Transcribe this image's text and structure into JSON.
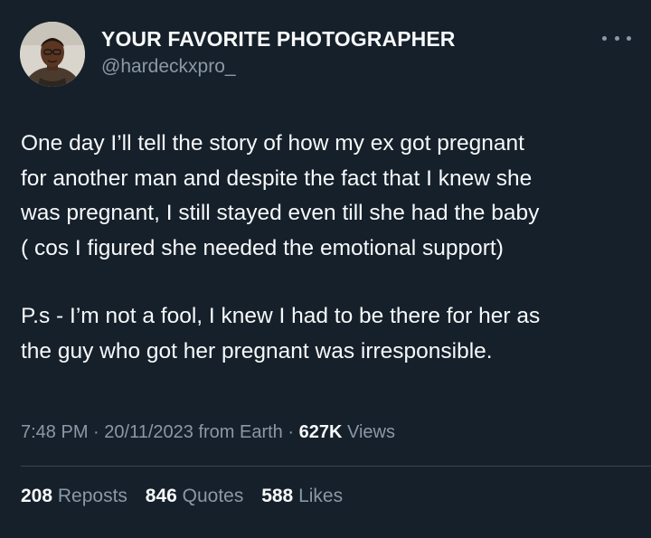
{
  "author": {
    "display_name": "YOUR FAVORITE PHOTOGRAPHER",
    "handle": "@hardeckxpro_",
    "avatar_icon": "user-avatar"
  },
  "more_icon": "more-horizontal-icon",
  "tweet": {
    "paragraph_1": [
      "One day I’ll tell the story of how my ex got pregnant",
      "for another man and despite the fact that I knew she",
      "was pregnant, I still stayed even till she had the baby",
      "( cos I figured she needed the emotional support)"
    ],
    "paragraph_2": [
      "P.s - I’m not a fool, I knew I had to be there for her as",
      "the guy who got her pregnant was irresponsible."
    ]
  },
  "meta": {
    "time": "7:48 PM",
    "separator": " · ",
    "date": "20/11/2023",
    "source": " from Earth",
    "views_count": "627K",
    "views_label": " Views"
  },
  "stats": {
    "reposts_count": "208",
    "reposts_label": " Reposts",
    "quotes_count": "846",
    "quotes_label": " Quotes",
    "likes_count": "588",
    "likes_label": " Likes"
  },
  "colors": {
    "background": "#15202b",
    "text_primary": "#f7f9f9",
    "text_secondary": "#8b98a5",
    "divider": "#38444d"
  }
}
